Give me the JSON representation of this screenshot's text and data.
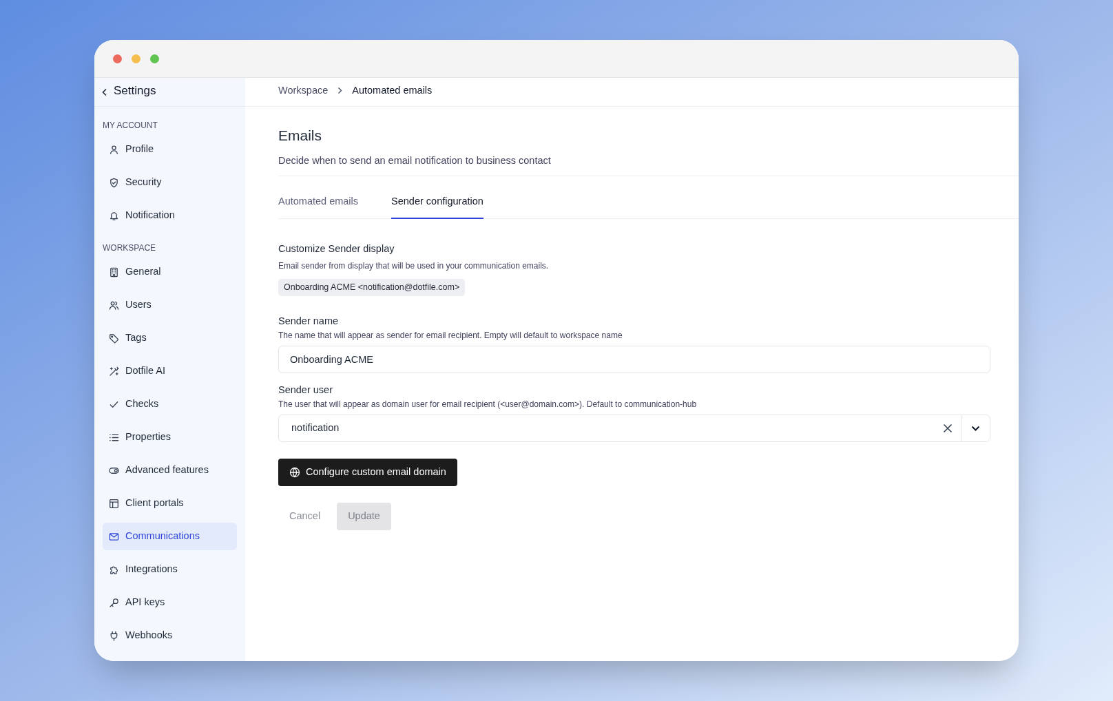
{
  "sidebar": {
    "back_label": "Settings",
    "sections": [
      {
        "heading": "MY ACCOUNT",
        "items": [
          {
            "label": "Profile",
            "selected": false
          },
          {
            "label": "Security",
            "selected": false
          },
          {
            "label": "Notification",
            "selected": false
          }
        ]
      },
      {
        "heading": "WORKSPACE",
        "items": [
          {
            "label": "General",
            "selected": false
          },
          {
            "label": "Users",
            "selected": false
          },
          {
            "label": "Tags",
            "selected": false
          },
          {
            "label": "Dotfile AI",
            "selected": false
          },
          {
            "label": "Checks",
            "selected": false
          },
          {
            "label": "Properties",
            "selected": false
          },
          {
            "label": "Advanced features",
            "selected": false
          },
          {
            "label": "Client portals",
            "selected": false
          },
          {
            "label": "Communications",
            "selected": true
          },
          {
            "label": "Integrations",
            "selected": false
          },
          {
            "label": "API keys",
            "selected": false
          },
          {
            "label": "Webhooks",
            "selected": false
          }
        ]
      }
    ]
  },
  "breadcrumb": [
    "Workspace",
    "Automated emails"
  ],
  "page": {
    "title": "Emails",
    "description": "Decide when to send an email notification to business contact"
  },
  "tabs": [
    {
      "label": "Automated emails",
      "selected": false
    },
    {
      "label": "Sender configuration",
      "selected": true
    }
  ],
  "display": {
    "label": "Customize Sender display",
    "help": "Email sender from display that will be used in your communication emails.",
    "preview": "Onboarding ACME <notification@dotfile.com>"
  },
  "sender_name": {
    "label": "Sender name",
    "help": "The name that will appear as sender for email recipient. Empty will default to workspace name",
    "value": "Onboarding ACME"
  },
  "sender_user": {
    "label": "Sender user",
    "help": "The user that will appear as domain user for email recipient (<user@domain.com>). Default to communication-hub",
    "value": "notification"
  },
  "domain_button": "Configure custom email domain",
  "actions": [
    {
      "label": "Cancel",
      "kind": "text",
      "disabled": true
    },
    {
      "label": "Update",
      "kind": "filled",
      "disabled": true
    }
  ]
}
